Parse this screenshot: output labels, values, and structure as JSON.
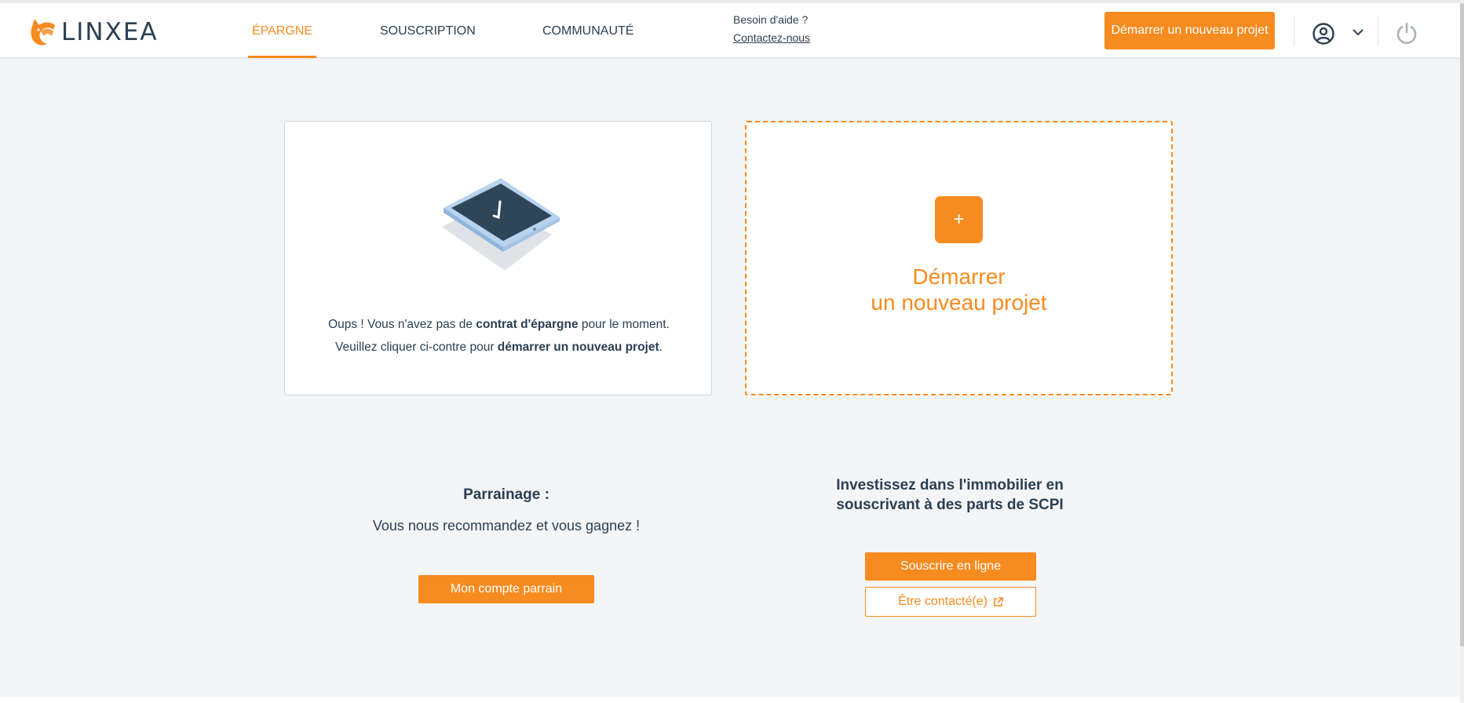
{
  "header": {
    "logo_text": "LINXEA",
    "nav": [
      {
        "label": "ÉPARGNE",
        "active": true
      },
      {
        "label": "SOUSCRIPTION",
        "active": false
      },
      {
        "label": "COMMUNAUTÉ",
        "active": false
      }
    ],
    "help_question": "Besoin d'aide ?",
    "help_link": "Contactez-nous",
    "cta_label": "Démarrer un nouveau projet",
    "icons": [
      "user-circle-icon",
      "chevron-down-icon",
      "power-icon"
    ]
  },
  "empty_state": {
    "line1_before": "Oups ! Vous n'avez pas de ",
    "line1_bold": "contrat d'épargne",
    "line1_after": " pour le moment.",
    "line2_before": "Veuillez cliquer ci-contre pour ",
    "line2_bold": "démarrer un nouveau projet",
    "line2_after": ".",
    "icon": "tablet-illustration-icon"
  },
  "new_project": {
    "plus": "+",
    "title_line1": "Démarrer",
    "title_line2": "un nouveau projet"
  },
  "parrainage": {
    "title": "Parrainage :",
    "subtitle": "Vous nous recommandez et vous gagnez !",
    "button": "Mon compte parrain"
  },
  "scpi": {
    "title_line1": "Investissez dans l'immobilier en",
    "title_line2": "souscrivant à des parts de SCPI",
    "button_primary": "Souscrire en ligne",
    "button_secondary": "Être contacté(e)"
  },
  "colors": {
    "accent": "#f68b1f",
    "text": "#2b3f52",
    "background": "#f4f5f7"
  }
}
